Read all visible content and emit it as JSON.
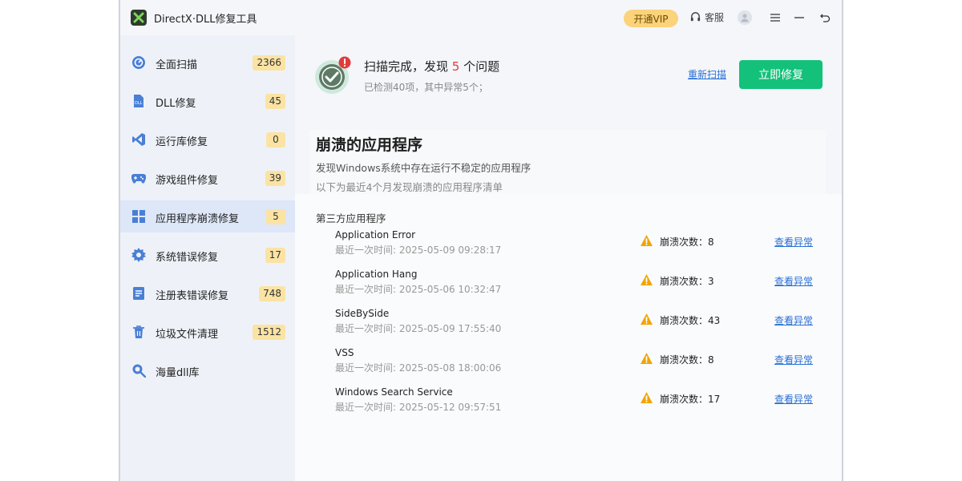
{
  "app": {
    "title": "DirectX·DLL修复工具"
  },
  "titlebar": {
    "vip_label": "开通VIP",
    "service_label": "客服"
  },
  "sidebar": {
    "items": [
      {
        "label": "全面扫描",
        "badge": "2366",
        "icon": "scan-icon"
      },
      {
        "label": "DLL修复",
        "badge": "45",
        "icon": "dll-icon"
      },
      {
        "label": "运行库修复",
        "badge": "0",
        "icon": "runtime-icon"
      },
      {
        "label": "游戏组件修复",
        "badge": "39",
        "icon": "gamepad-icon"
      },
      {
        "label": "应用程序崩溃修复",
        "badge": "5",
        "icon": "apps-icon"
      },
      {
        "label": "系统错误修复",
        "badge": "17",
        "icon": "gear-icon"
      },
      {
        "label": "注册表错误修复",
        "badge": "748",
        "icon": "registry-icon"
      },
      {
        "label": "垃圾文件清理",
        "badge": "1512",
        "icon": "trash-icon"
      },
      {
        "label": "海量dll库",
        "badge": "",
        "icon": "search-icon"
      }
    ],
    "active_index": 4
  },
  "summary": {
    "title_prefix": "扫描完成，发现 ",
    "issue_count": "5",
    "title_suffix": " 个问题",
    "subtitle": "已检测40项，其中异常5个；",
    "rescan_label": "重新扫描",
    "fix_label": "立即修复"
  },
  "section": {
    "title": "崩溃的应用程序",
    "desc1": "发现Windows系统中存在运行不稳定的应用程序",
    "desc2": "以下为最近4个月发现崩溃的应用程序清单",
    "group_label": "第三方应用程序"
  },
  "crash_list": [
    {
      "name": "Application Error",
      "time": "最近一次时间: 2025-05-09 09:28:17",
      "count": "崩溃次数：8",
      "link": "查看异常"
    },
    {
      "name": "Application Hang",
      "time": "最近一次时间: 2025-05-06 10:32:47",
      "count": "崩溃次数：3",
      "link": "查看异常"
    },
    {
      "name": "SideBySide",
      "time": "最近一次时间: 2025-05-09 17:55:40",
      "count": "崩溃次数：43",
      "link": "查看异常"
    },
    {
      "name": "VSS",
      "time": "最近一次时间: 2025-05-08 18:00:06",
      "count": "崩溃次数：8",
      "link": "查看异常"
    },
    {
      "name": "Windows Search Service",
      "time": "最近一次时间: 2025-05-12 09:57:51",
      "count": "崩溃次数：17",
      "link": "查看异常"
    }
  ],
  "colors": {
    "accent": "#14c17a",
    "link": "#2a6fd6",
    "badge": "#fbe3a3",
    "warning": "#f0a500",
    "issue": "#e23b3b"
  }
}
